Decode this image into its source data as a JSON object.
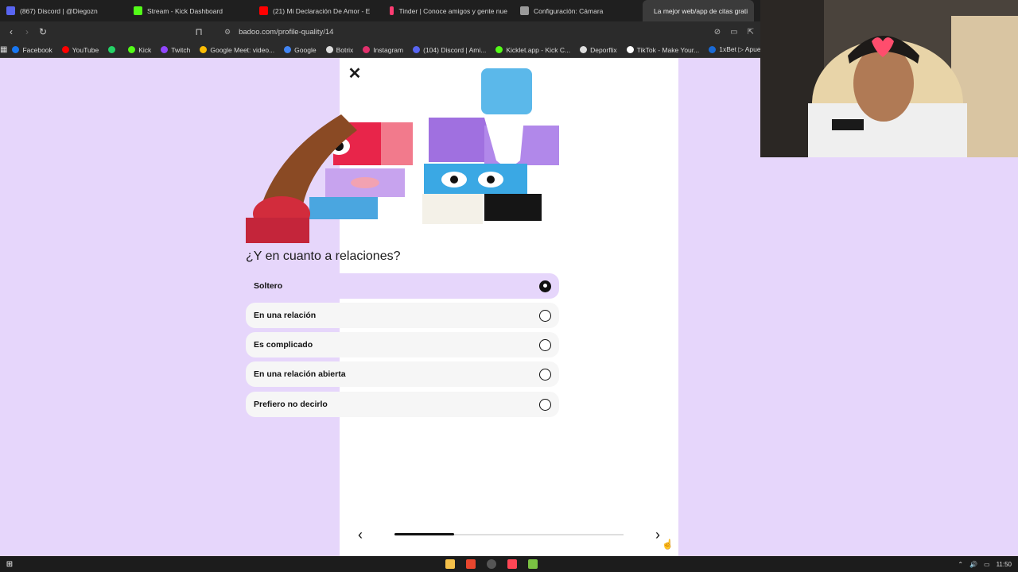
{
  "browser": {
    "tabs": [
      {
        "label": "(867) Discord | @Diegozn",
        "color": "#5865f2"
      },
      {
        "label": "Stream - Kick Dashboard",
        "color": "#53fc18"
      },
      {
        "label": "(21) Mi Declaración De Amor - E",
        "color": "#ff0000"
      },
      {
        "label": "Tinder | Conoce amigos y gente nue",
        "color": "#fe3c72"
      },
      {
        "label": "Configuración: Cámara",
        "color": "#9a9a9a"
      },
      {
        "label": "La mejor web/app de citas grati",
        "color": "#c56cf0"
      }
    ],
    "url": "badoo.com/profile-quality/14",
    "bookmarks": [
      {
        "label": "Facebook",
        "color": "#1877f2"
      },
      {
        "label": "YouTube",
        "color": "#ff0000"
      },
      {
        "label": "",
        "color": "#25d366"
      },
      {
        "label": "Kick",
        "color": "#53fc18"
      },
      {
        "label": "Twitch",
        "color": "#9146ff"
      },
      {
        "label": "Google Meet: video...",
        "color": "#fbbc04"
      },
      {
        "label": "Google",
        "color": "#4285f4"
      },
      {
        "label": "Botrix",
        "color": "#dddddd"
      },
      {
        "label": "Instagram",
        "color": "#e1306c"
      },
      {
        "label": "(104) Discord | Ami...",
        "color": "#5865f2"
      },
      {
        "label": "Kicklet.app - Kick C...",
        "color": "#53fc18"
      },
      {
        "label": "Deporflix",
        "color": "#dddddd"
      },
      {
        "label": "TikTok - Make Your...",
        "color": "#ffffff"
      },
      {
        "label": "1xBet ▷ Apues",
        "color": "#1a6ad6"
      }
    ]
  },
  "page": {
    "question": "¿Y en cuanto a relaciones?",
    "options": [
      {
        "label": "Soltero",
        "selected": true
      },
      {
        "label": "En una relación",
        "selected": false
      },
      {
        "label": "Es complicado",
        "selected": false
      },
      {
        "label": "En una relación abierta",
        "selected": false
      },
      {
        "label": "Prefiero no decirlo",
        "selected": false
      }
    ],
    "progress": 0.26
  },
  "taskbar": {
    "time": "11:50"
  },
  "colors": {
    "accent": "#e6d6fb",
    "panel": "#ffffff"
  }
}
